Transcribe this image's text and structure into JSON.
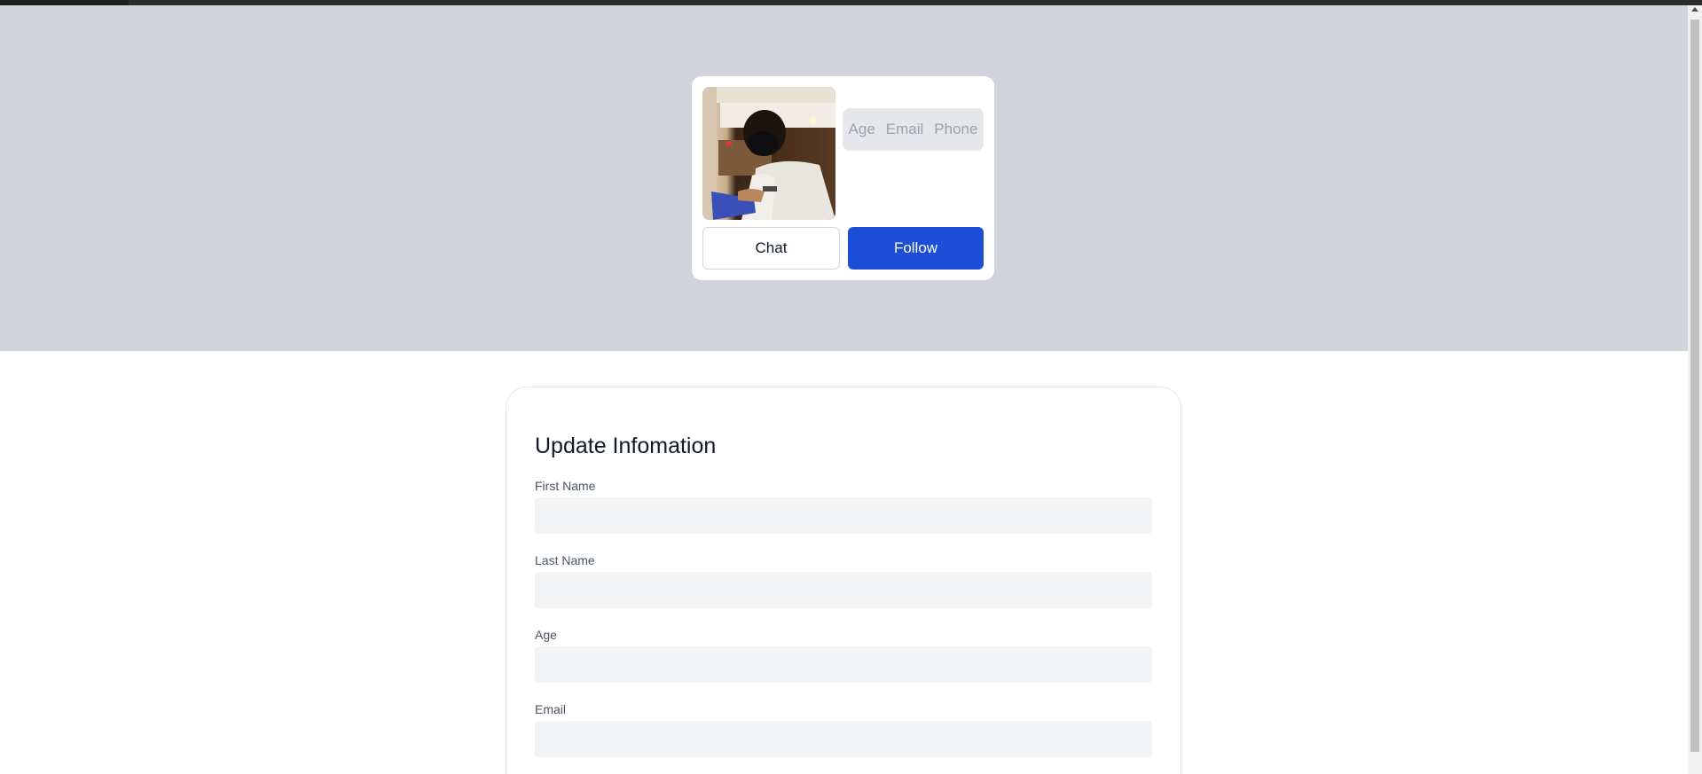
{
  "profile": {
    "avatar_alt": "Profile photo",
    "stats": [
      "Age",
      "Email",
      "Phone"
    ],
    "chat_label": "Chat",
    "follow_label": "Follow"
  },
  "form": {
    "title": "Update Infomation",
    "fields": [
      {
        "label": "First Name",
        "value": "",
        "placeholder": ""
      },
      {
        "label": "Last Name",
        "value": "",
        "placeholder": ""
      },
      {
        "label": "Age",
        "value": "",
        "placeholder": ""
      },
      {
        "label": "Email",
        "value": "",
        "placeholder": ""
      }
    ]
  },
  "colors": {
    "banner": "#d1d5db",
    "follow_button": "#1d4ed8",
    "input_bg": "#f3f4f6"
  },
  "icons": {
    "scroll_up": "triangle-up-icon"
  }
}
